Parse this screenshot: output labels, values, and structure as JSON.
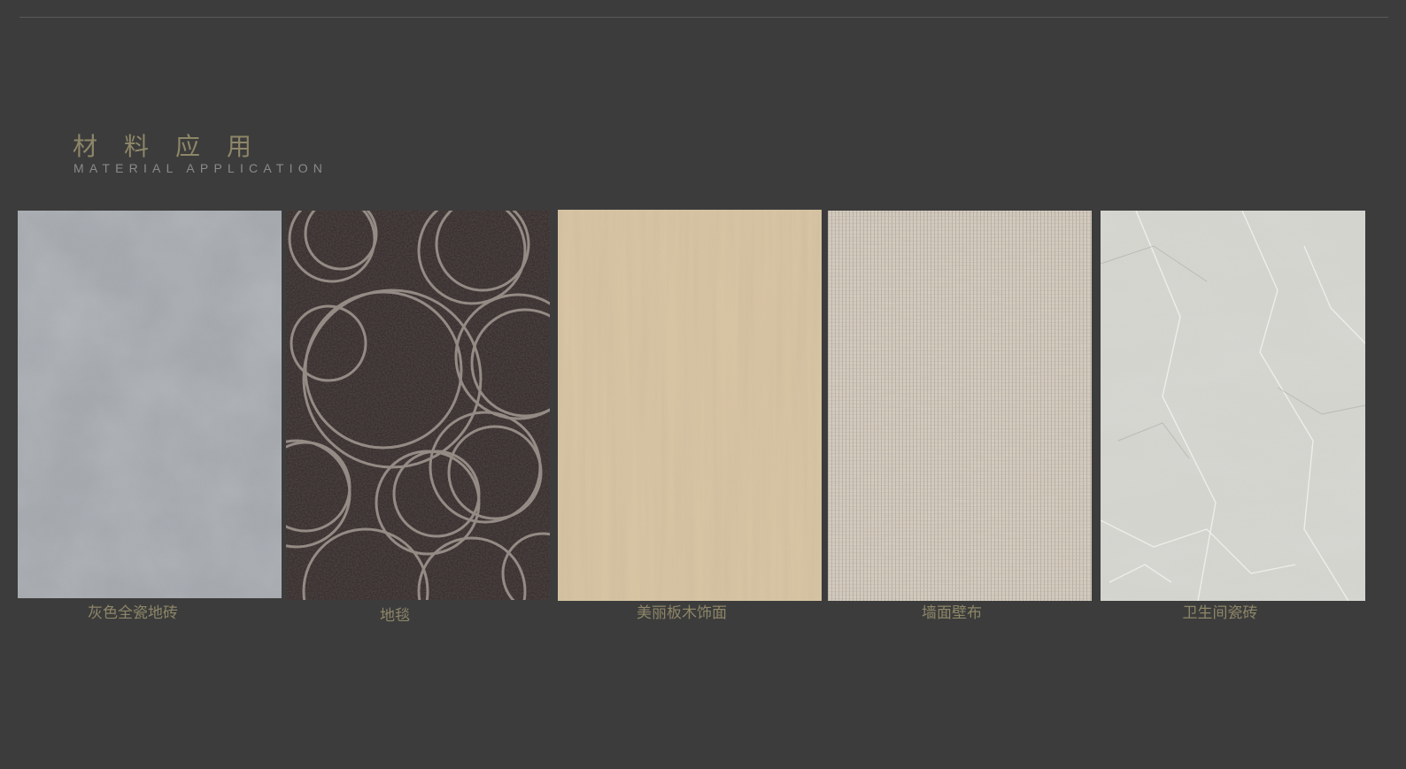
{
  "header": {
    "title_zh": "材料应用",
    "title_en": "MATERIAL APPLICATION"
  },
  "materials": [
    {
      "name": "灰色全瓷地砖",
      "texture": "grey-porcelain-floor-tile"
    },
    {
      "name": "地毯",
      "texture": "dark-carpet-circle-pattern"
    },
    {
      "name": "美丽板木饰面",
      "texture": "light-wood-veneer"
    },
    {
      "name": "墙面壁布",
      "texture": "woven-wall-fabric"
    },
    {
      "name": "卫生间瓷砖",
      "texture": "grey-marble-tile"
    }
  ],
  "colors": {
    "background": "#3c3c3c",
    "accent_gold": "#8d8668",
    "subtitle_grey": "#8a8a8a"
  }
}
